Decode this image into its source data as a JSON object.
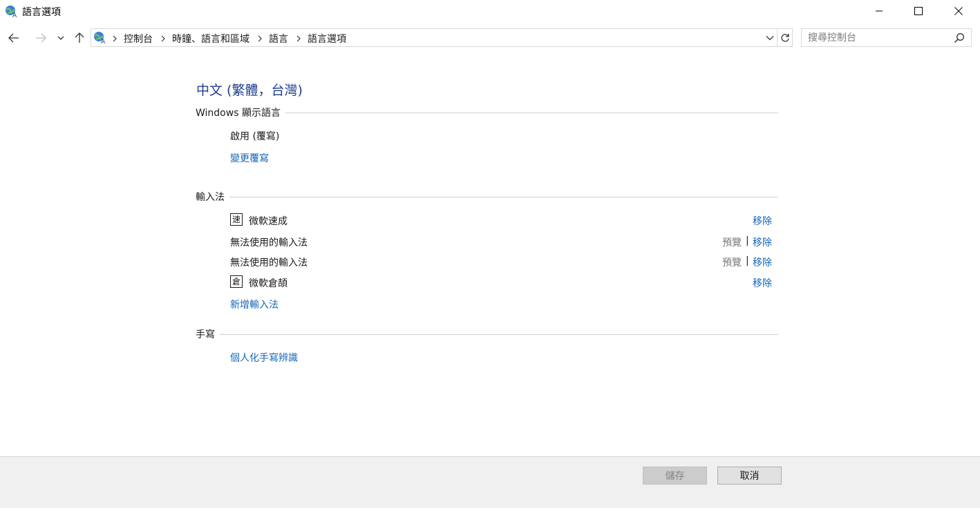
{
  "window": {
    "title": "語言選項",
    "app_icon": "globe-language-icon"
  },
  "nav": {
    "back_icon": "arrow-left-icon",
    "forward_icon": "arrow-right-icon",
    "recent_icon": "chevron-down-icon",
    "up_icon": "arrow-up-icon",
    "breadcrumbs": [
      "控制台",
      "時鐘、語言和區域",
      "語言",
      "語言選項"
    ],
    "search_placeholder": "搜尋控制台"
  },
  "content": {
    "language_title": "中文 (繁體，台灣)",
    "display_section": {
      "heading": "Windows 顯示語言",
      "status": "啟用 (覆寫)",
      "change_link": "變更覆寫"
    },
    "ime_section": {
      "heading": "輸入法",
      "items": [
        {
          "badge": "速",
          "name": "微軟速成",
          "preview": "",
          "remove": "移除"
        },
        {
          "badge": "",
          "name": "無法使用的輸入法",
          "preview": "預覽",
          "remove": "移除"
        },
        {
          "badge": "",
          "name": "無法使用的輸入法",
          "preview": "預覽",
          "remove": "移除"
        },
        {
          "badge": "倉",
          "name": "微軟倉頡",
          "preview": "",
          "remove": "移除"
        }
      ],
      "separator": "|",
      "add_link": "新增輸入法"
    },
    "handwriting_section": {
      "heading": "手寫",
      "personalize_link": "個人化手寫辨識"
    }
  },
  "footer": {
    "save_label": "儲存",
    "cancel_label": "取消"
  },
  "colors": {
    "link": "#1466b8",
    "title_blue": "#1e3d8f",
    "footer_bg": "#f0f0f0"
  }
}
